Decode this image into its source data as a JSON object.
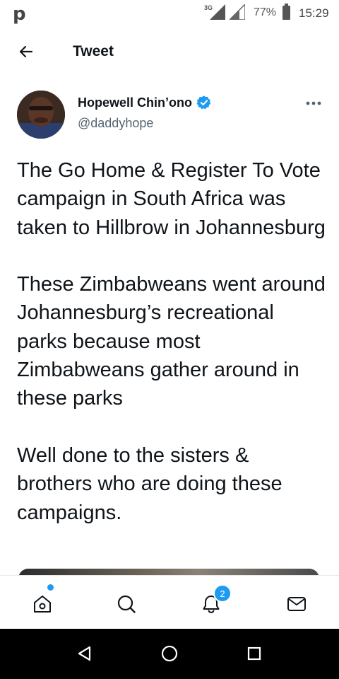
{
  "status_bar": {
    "network": "3G",
    "battery": "77%",
    "time": "15:29"
  },
  "header": {
    "title": "Tweet"
  },
  "author": {
    "name": "Hopewell Chin’ono",
    "handle": "@daddyhope",
    "verified": true
  },
  "tweet": {
    "paragraphs": [
      "The Go Home & Register To Vote campaign in South Africa was taken to Hillbrow in Johannesburg",
      "These Zimbabweans went around Johannesburg’s recreational parks because most Zimbabweans gather around in these parks",
      "Well done to the sisters & brothers who are doing these campaigns."
    ]
  },
  "bottom_nav": {
    "items": [
      "home-icon",
      "search-icon",
      "notifications-icon",
      "messages-icon"
    ],
    "notifications_badge": "2"
  },
  "colors": {
    "accent": "#1d9bf0",
    "text": "#0f1419",
    "secondary": "#536471"
  }
}
